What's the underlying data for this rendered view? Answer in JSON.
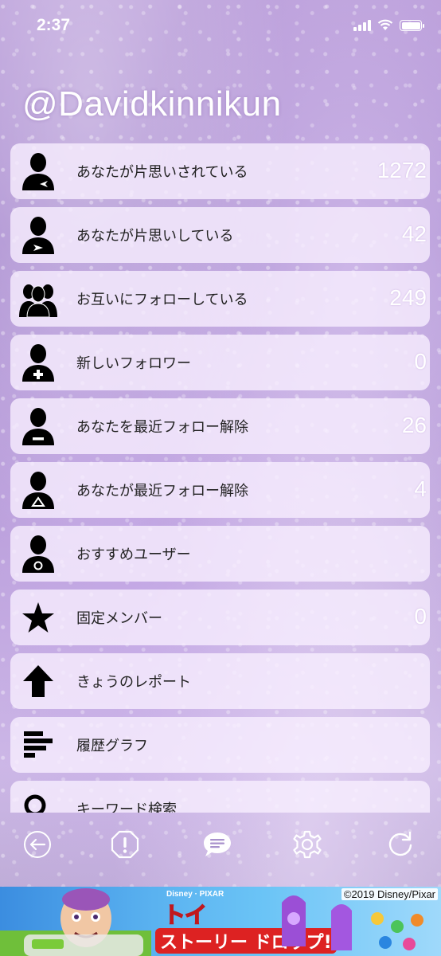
{
  "status_bar": {
    "time": "2:37"
  },
  "header": {
    "username": "@Davidkinnikun"
  },
  "menu_items": [
    {
      "label": "あなたが片思いされている",
      "count": "1272",
      "icon": "person-arrow-left-icon"
    },
    {
      "label": "あなたが片思いしている",
      "count": "42",
      "icon": "person-arrow-right-icon"
    },
    {
      "label": "お互いにフォローしている",
      "count": "249",
      "icon": "people-group-icon"
    },
    {
      "label": "新しいフォロワー",
      "count": "0",
      "icon": "person-plus-icon"
    },
    {
      "label": "あなたを最近フォロー解除",
      "count": "26",
      "icon": "person-minus-icon"
    },
    {
      "label": "あなたが最近フォロー解除",
      "count": "4",
      "icon": "person-triangle-icon"
    },
    {
      "label": "おすすめユーザー",
      "count": "",
      "icon": "person-circle-icon"
    },
    {
      "label": "固定メンバー",
      "count": "0",
      "icon": "star-icon"
    },
    {
      "label": "きょうのレポート",
      "count": "",
      "icon": "arrow-up-icon"
    },
    {
      "label": "履歴グラフ",
      "count": "",
      "icon": "bar-graph-icon"
    },
    {
      "label": "キーワード検索",
      "count": "",
      "icon": "search-icon"
    }
  ],
  "toolbar": [
    {
      "name": "back-icon"
    },
    {
      "name": "alert-icon"
    },
    {
      "name": "chat-icon"
    },
    {
      "name": "settings-icon"
    },
    {
      "name": "refresh-icon"
    }
  ],
  "ad": {
    "copyright": "©2019 Disney/Pixar",
    "brand": "Disney · PIXAR",
    "title": "トイ",
    "subtitle": "ストーリー ドロップ!"
  }
}
